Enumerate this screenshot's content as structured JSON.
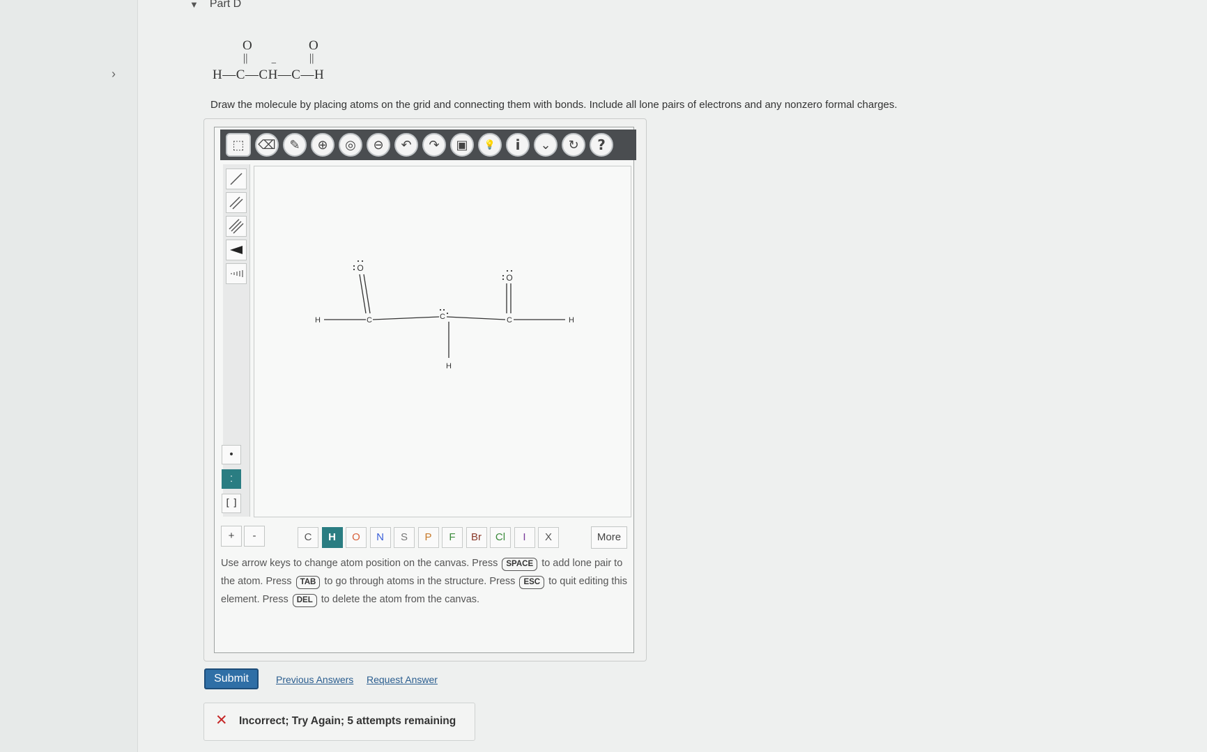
{
  "part": {
    "title": "Part D"
  },
  "formula": {
    "o1": "O",
    "o2": "O",
    "bond1": "||",
    "bond2": "||",
    "line": "H—C—CH—C—H",
    "charge": "−"
  },
  "instructions": "Draw the molecule by placing atoms on the grid and connecting them with bonds. Include all lone pairs of electrons and any nonzero formal charges.",
  "toolbar": {
    "tools": [
      {
        "name": "select-tool",
        "icon": "selection-icon",
        "glyph": "⬚"
      },
      {
        "name": "eraser-tool",
        "icon": "eraser-icon",
        "glyph": "⌫"
      },
      {
        "name": "pen-tool",
        "icon": "pencil-icon",
        "glyph": "✎"
      },
      {
        "name": "zoom-in-tool",
        "icon": "zoom-in-icon",
        "glyph": "⊕"
      },
      {
        "name": "zoom-reset-tool",
        "icon": "zoom-fit-icon",
        "glyph": "◎"
      },
      {
        "name": "zoom-out-tool",
        "icon": "zoom-out-icon",
        "glyph": "⊖"
      },
      {
        "name": "undo-tool",
        "icon": "undo-icon",
        "glyph": "↶"
      },
      {
        "name": "redo-tool",
        "icon": "redo-icon",
        "glyph": "↷"
      },
      {
        "name": "template-tool",
        "icon": "template-icon",
        "glyph": "▣"
      },
      {
        "name": "hint-tool",
        "icon": "lightbulb-icon",
        "glyph": "💡"
      },
      {
        "name": "info-tool",
        "icon": "info-icon",
        "glyph": "i"
      },
      {
        "name": "dropdown-tool",
        "icon": "chevron-down-icon",
        "glyph": "⌄"
      },
      {
        "name": "reset-tool",
        "icon": "reset-icon",
        "glyph": "↻"
      },
      {
        "name": "help-tool",
        "icon": "help-icon",
        "glyph": "?"
      }
    ]
  },
  "bond_tools": [
    "single-bond",
    "double-bond",
    "triple-bond",
    "wedge-bond",
    "hash-bond"
  ],
  "electron_tools": [
    "single-electron",
    "lone-pair",
    "brackets"
  ],
  "electron_tool_labels": {
    "brackets": "[ ]"
  },
  "molecule": {
    "h_left": "H",
    "c1": "C",
    "o1": "O",
    "c2": "C",
    "h_mid": "H",
    "c3": "C",
    "o2": "O",
    "h_right": "H"
  },
  "charge_buttons": {
    "plus": "+",
    "minus": "-"
  },
  "atoms": [
    "C",
    "H",
    "O",
    "N",
    "S",
    "P",
    "F",
    "Br",
    "Cl",
    "I",
    "X"
  ],
  "active_atom": "H",
  "more_label": "More",
  "help": {
    "t1": "Use arrow keys to change atom position on the canvas. Press",
    "k1": "SPACE",
    "t2": "to add lone pair to the atom. Press",
    "k2": "TAB",
    "t3": "to go through atoms in the structure. Press",
    "k3": "ESC",
    "t4": "to quit editing this element. Press",
    "k4": "DEL",
    "t5": "to delete the atom from the canvas."
  },
  "actions": {
    "submit": "Submit",
    "previous_answers": "Previous Answers",
    "request_answer": "Request Answer"
  },
  "feedback": {
    "message": "Incorrect; Try Again; 5 attempts remaining"
  },
  "colors": {
    "accent": "#2a7d82",
    "submit": "#2f6fa6",
    "error": "#c62828"
  }
}
